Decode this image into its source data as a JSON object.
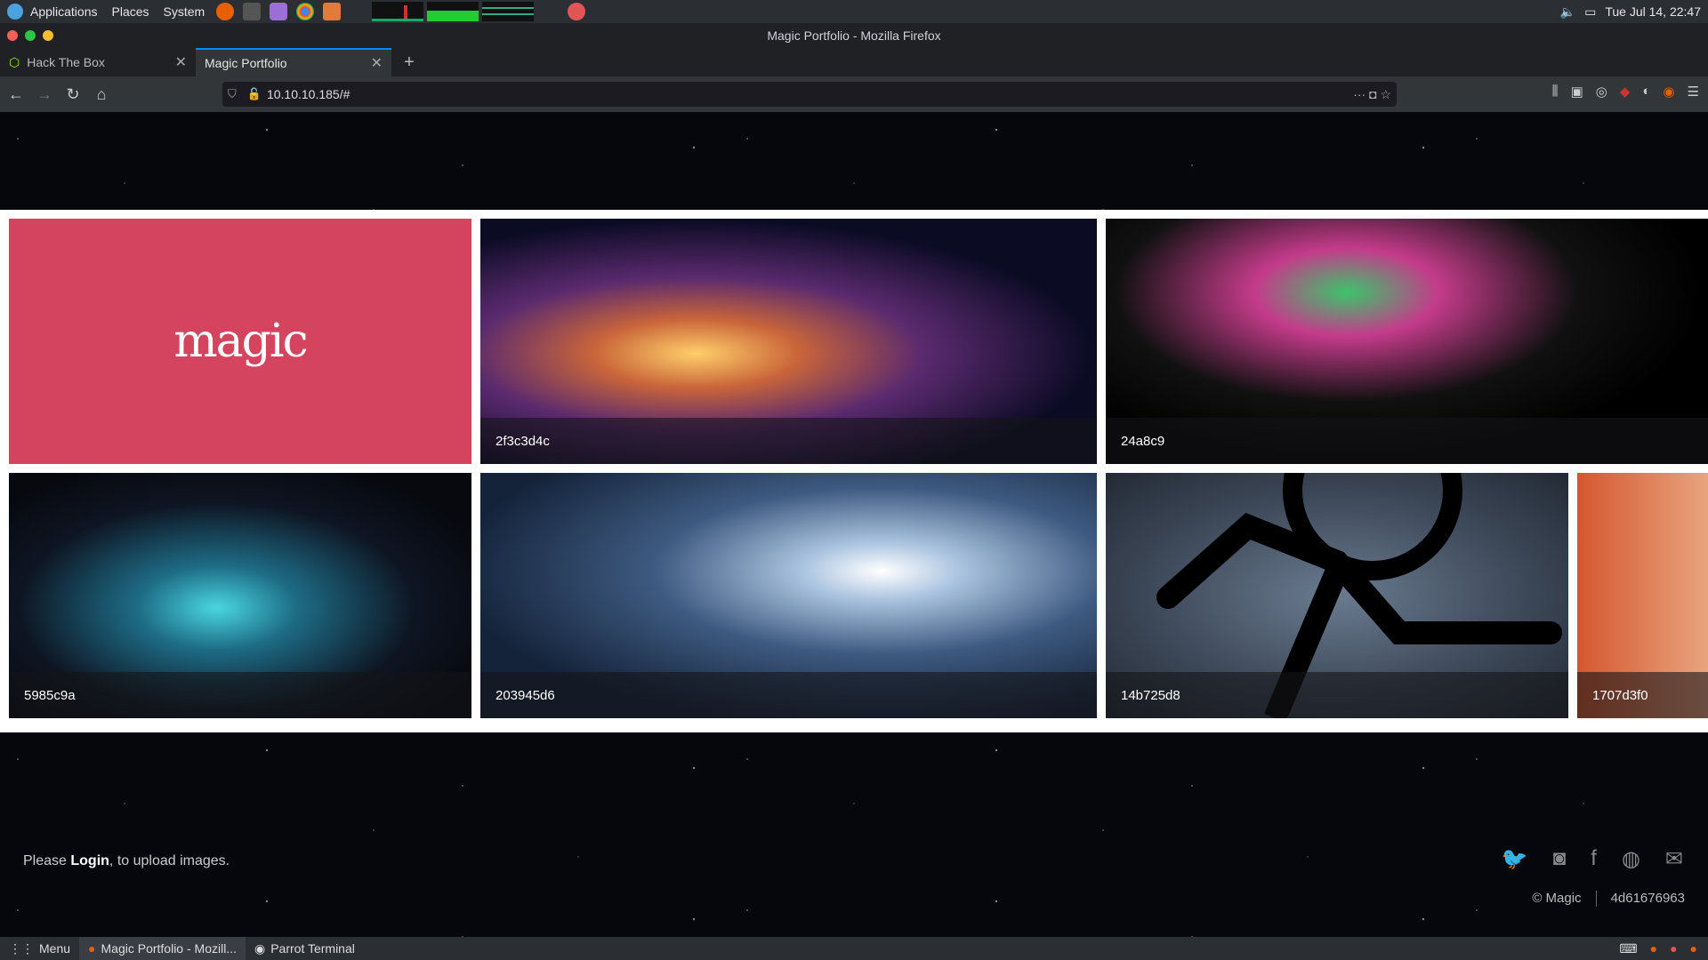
{
  "top_panel": {
    "menus": [
      "Applications",
      "Places",
      "System"
    ],
    "clock": "Tue Jul 14, 22:47"
  },
  "window": {
    "title": "Magic Portfolio - Mozilla Firefox"
  },
  "tabs": [
    {
      "label": "Hack The Box"
    },
    {
      "label": "Magic Portfolio"
    }
  ],
  "url": "10.10.10.185/#",
  "gallery": {
    "logo_text": "magic",
    "items": [
      {
        "caption": "2f3c3d4c"
      },
      {
        "caption": "24a8c9"
      },
      {
        "caption": "5985c9a"
      },
      {
        "caption": "203945d6"
      },
      {
        "caption": "14b725d8"
      },
      {
        "caption": "1707d3f0"
      }
    ]
  },
  "footer": {
    "login_prefix": "Please ",
    "login_link": "Login",
    "login_suffix": ", to upload images.",
    "copyright": "© Magic",
    "hash": "4d61676963",
    "social_icons": [
      "twitter-icon",
      "instagram-icon",
      "facebook-icon",
      "dribbble-icon",
      "email-icon"
    ]
  },
  "taskbar": {
    "menu_label": "Menu",
    "tasks": [
      "Magic Portfolio - Mozill...",
      "Parrot Terminal"
    ]
  },
  "colors": {
    "accent": "#0a84ff",
    "logo_tile": "#d4445e"
  }
}
